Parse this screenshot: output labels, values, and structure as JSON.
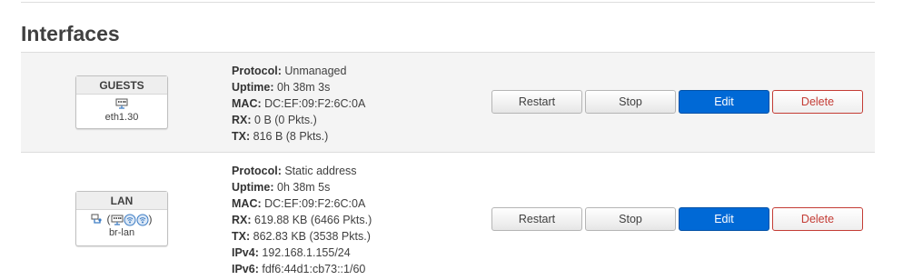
{
  "section_title": "Interfaces",
  "interfaces": [
    {
      "name": "GUESTS",
      "device": "eth1.30",
      "details": [
        {
          "label": "Protocol:",
          "value": "Unmanaged"
        },
        {
          "label": "Uptime:",
          "value": "0h 38m 3s"
        },
        {
          "label": "MAC:",
          "value": "DC:EF:09:F2:6C:0A"
        },
        {
          "label": "RX:",
          "value": "0 B (0 Pkts.)"
        },
        {
          "label": "TX:",
          "value": "816 B (8 Pkts.)"
        }
      ],
      "icons": [
        "ethernet-port-icon"
      ]
    },
    {
      "name": "LAN",
      "device": "br-lan",
      "details": [
        {
          "label": "Protocol:",
          "value": "Static address"
        },
        {
          "label": "Uptime:",
          "value": "0h 38m 5s"
        },
        {
          "label": "MAC:",
          "value": "DC:EF:09:F2:6C:0A"
        },
        {
          "label": "RX:",
          "value": "619.88 KB (6466 Pkts.)"
        },
        {
          "label": "TX:",
          "value": "862.83 KB (3538 Pkts.)"
        },
        {
          "label": "IPv4:",
          "value": "192.168.1.155/24"
        },
        {
          "label": "IPv6:",
          "value": "fdf6:44d1:cb73::1/60"
        }
      ],
      "icons": [
        "bridge-icon",
        "ethernet-port-icon",
        "wifi-icon",
        "wifi-icon"
      ]
    }
  ],
  "buttons": {
    "restart": "Restart",
    "stop": "Stop",
    "edit": "Edit",
    "delete": "Delete"
  },
  "colors": {
    "edit_bg": "#0069d6",
    "delete_text": "#c43c35",
    "row_alt_bg": "#f4f4f4"
  }
}
